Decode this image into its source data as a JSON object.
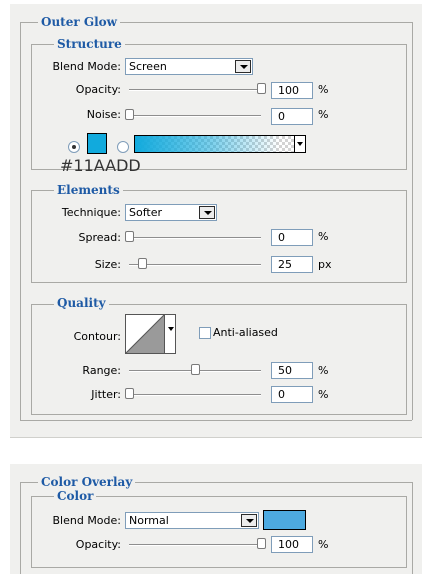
{
  "outer_glow": {
    "title": "Outer Glow",
    "structure": {
      "title": "Structure",
      "blend_mode": {
        "label": "Blend Mode:",
        "value": "Screen"
      },
      "opacity": {
        "label": "Opacity:",
        "value": "100",
        "unit": "%",
        "level": 1.0
      },
      "noise": {
        "label": "Noise:",
        "value": "0",
        "unit": "%",
        "level": 0.0
      },
      "color_mode": "solid",
      "color": "#11AADD",
      "color_label": "#11AADD"
    },
    "elements": {
      "title": "Elements",
      "technique": {
        "label": "Technique:",
        "value": "Softer"
      },
      "spread": {
        "label": "Spread:",
        "value": "0",
        "unit": "%",
        "level": 0.0
      },
      "size": {
        "label": "Size:",
        "value": "25",
        "unit": "px",
        "level": 0.1
      }
    },
    "quality": {
      "title": "Quality",
      "contour_label": "Contour:",
      "anti_aliased": {
        "label": "Anti-aliased",
        "checked": false
      },
      "range": {
        "label": "Range:",
        "value": "50",
        "unit": "%",
        "level": 0.5
      },
      "jitter": {
        "label": "Jitter:",
        "value": "0",
        "unit": "%",
        "level": 0.0
      }
    }
  },
  "color_overlay": {
    "title": "Color Overlay",
    "color": {
      "title": "Color",
      "blend_mode": {
        "label": "Blend Mode:",
        "value": "Normal"
      },
      "swatch_color": "#4DAAE0",
      "opacity": {
        "label": "Opacity:",
        "value": "100",
        "unit": "%",
        "level": 1.0
      }
    }
  },
  "icons": [
    "dropdown-arrow-icon",
    "radio-selected-icon",
    "radio-unselected-icon",
    "slider-thumb-icon",
    "contour-curve-icon",
    "checkbox-icon"
  ]
}
